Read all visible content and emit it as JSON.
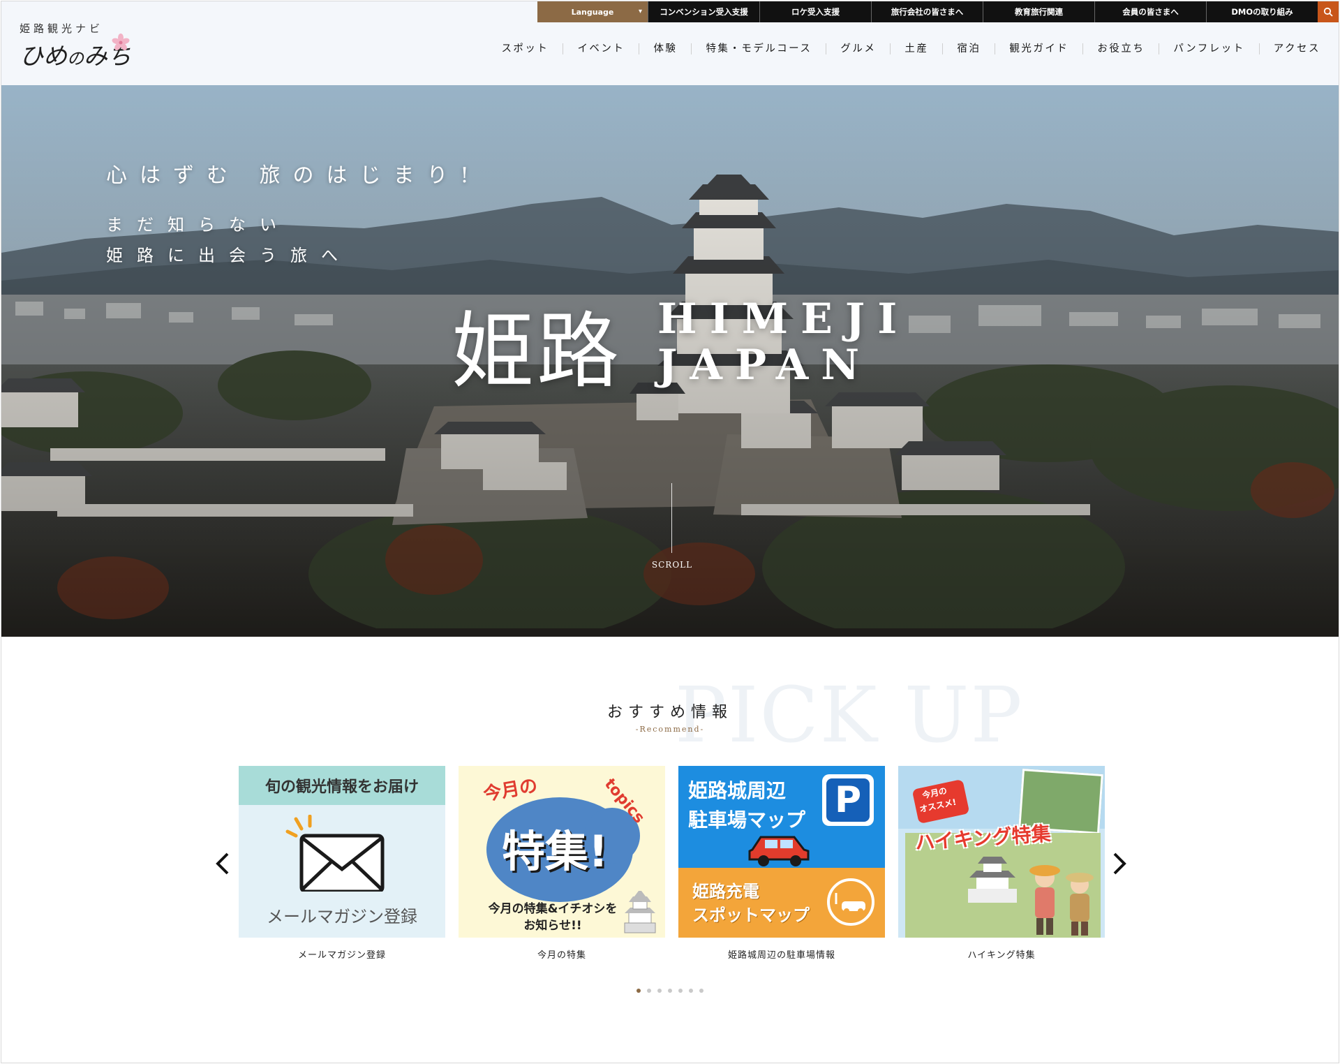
{
  "brand": {
    "site_subtitle": "姫路観光ナビ",
    "logo_main": "ひめ",
    "logo_small": "の",
    "logo_rest": "みち"
  },
  "topbar": {
    "language_label": "Language",
    "links": [
      "コンベンション受入支援",
      "ロケ受入支援",
      "旅行会社の皆さまへ",
      "教育旅行関連",
      "会員の皆さまへ",
      "DMOの取り組み"
    ]
  },
  "nav": {
    "items": [
      "スポット",
      "イベント",
      "体験",
      "特集・モデルコース",
      "グルメ",
      "土産",
      "宿泊",
      "観光ガイド",
      "お役立ち",
      "パンフレット",
      "アクセス"
    ]
  },
  "hero": {
    "tagline": "心はずむ 旅のはじまり!",
    "subline_1": "まだ知らない",
    "subline_2": "姫路に出会う旅へ",
    "title_kanji": "姫路",
    "title_latin_1": "HIMEJI",
    "title_latin_2": "JAPAN",
    "scroll_label": "SCROLL"
  },
  "pickup": {
    "bg_text": "PICK UP",
    "title": "おすすめ情報",
    "subtitle": "-Recommend-",
    "cards": [
      {
        "caption": "メールマガジン登録",
        "banner_top": "旬の観光情報をお届け",
        "banner_bottom": "メールマガジン登録"
      },
      {
        "caption": "今月の特集",
        "banner_month": "今月の",
        "banner_big": "特集!",
        "banner_topics": "topics",
        "banner_line1": "今月の特集&イチオシを",
        "banner_line2": "お知らせ!!"
      },
      {
        "caption": "姫路城周辺の駐車場情報",
        "banner_line1": "姫路城周辺",
        "banner_line2": "駐車場マップ",
        "banner_p": "P",
        "banner_line3": "姫路充電",
        "banner_line4": "スポットマップ"
      },
      {
        "caption": "ハイキング特集",
        "banner_badge_1": "今月の",
        "banner_badge_2": "オススメ!",
        "banner_title": "ハイキング特集"
      }
    ],
    "dots_count": 7,
    "active_dot": 0
  },
  "colors": {
    "accent_brown": "#8c6a45",
    "search_orange": "#c8561a",
    "dark_bar": "#111111"
  }
}
